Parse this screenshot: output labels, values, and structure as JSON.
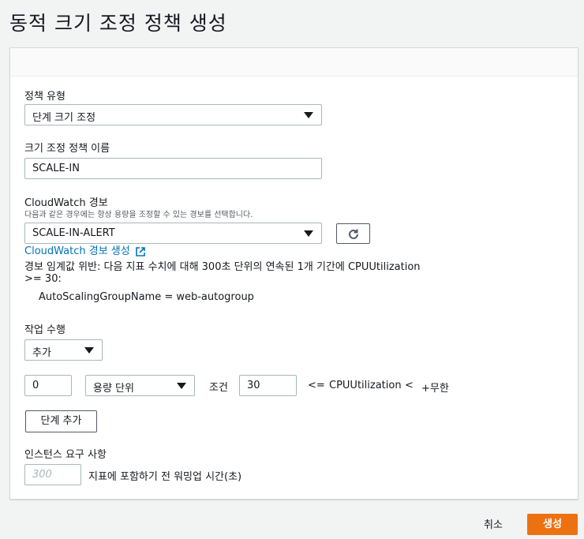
{
  "page": {
    "title": "동적 크기 조정 정책 생성"
  },
  "policy_type": {
    "label": "정책 유형",
    "selected": "단계 크기 조정"
  },
  "policy_name": {
    "label": "크기 조정 정책 이름",
    "value": "SCALE-IN"
  },
  "cloudwatch_alarm": {
    "label": "CloudWatch 경보",
    "description": "다음과 같은 경우에는 항상 용량을 조정할 수 있는 경보를 선택합니다.",
    "selected": "SCALE-IN-ALERT",
    "refresh_icon": "refresh-icon",
    "create_link": "CloudWatch 경보 생성",
    "breach_line1": "경보 임계값 위반: 다음 지표 수치에 대해 300초 단위의 연속된 1개 기간에 CPUUtilization",
    "breach_line2": ">= 30:",
    "dimension": "AutoScalingGroupName = web-autogroup"
  },
  "action": {
    "label": "작업 수행",
    "selected": "추가"
  },
  "step": {
    "amount": "0",
    "unit": "용량 단위",
    "condition_label": "조건",
    "lower": "30",
    "lte": "<=",
    "metric": "CPUUtilization",
    "lt": "<",
    "upper": "+무한"
  },
  "add_step_button": "단계 추가",
  "warmup": {
    "label": "인스턴스 요구 사항",
    "placeholder": "300",
    "suffix": "지표에 포함하기 전 워밍업 시간(초)"
  },
  "footer": {
    "cancel": "취소",
    "create": "생성"
  },
  "colors": {
    "primary": "#ec7211",
    "link": "#0073bb",
    "border": "#aab7b8"
  }
}
